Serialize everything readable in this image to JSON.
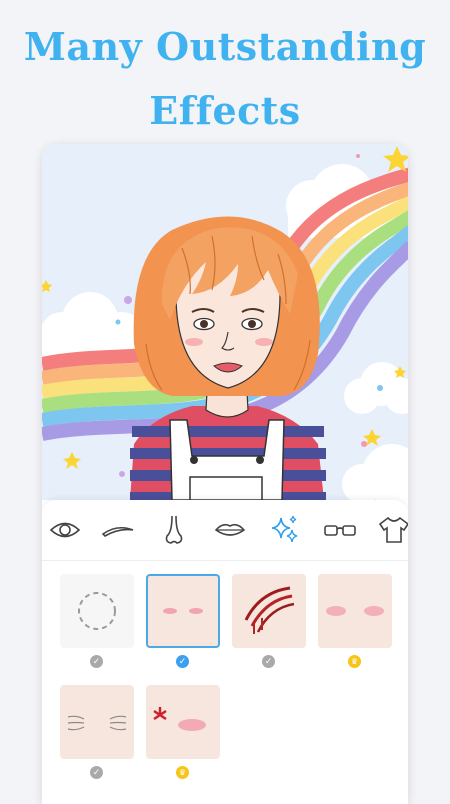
{
  "headline": {
    "line1": "Many Outstanding",
    "line2": "Effects"
  },
  "categories": [
    {
      "icon": "eye-icon"
    },
    {
      "icon": "eyebrow-icon"
    },
    {
      "icon": "nose-icon"
    },
    {
      "icon": "lips-icon"
    },
    {
      "icon": "sparkle-effects-icon",
      "active": true
    },
    {
      "icon": "glasses-icon"
    },
    {
      "icon": "shirt-icon"
    }
  ],
  "effects": [
    {
      "id": "none",
      "status": "check",
      "selected": false
    },
    {
      "id": "light-blush",
      "status": "check",
      "selected": true
    },
    {
      "id": "scratch-wound",
      "status": "check",
      "selected": false
    },
    {
      "id": "soft-blush",
      "status": "premium",
      "selected": false
    },
    {
      "id": "tired-lines",
      "status": "check",
      "selected": false
    },
    {
      "id": "angry-mark",
      "status": "premium",
      "selected": false
    }
  ],
  "colors": {
    "accent": "#3fb2ef",
    "selected_border": "#4aa9e6",
    "premium": "#f5c518"
  }
}
